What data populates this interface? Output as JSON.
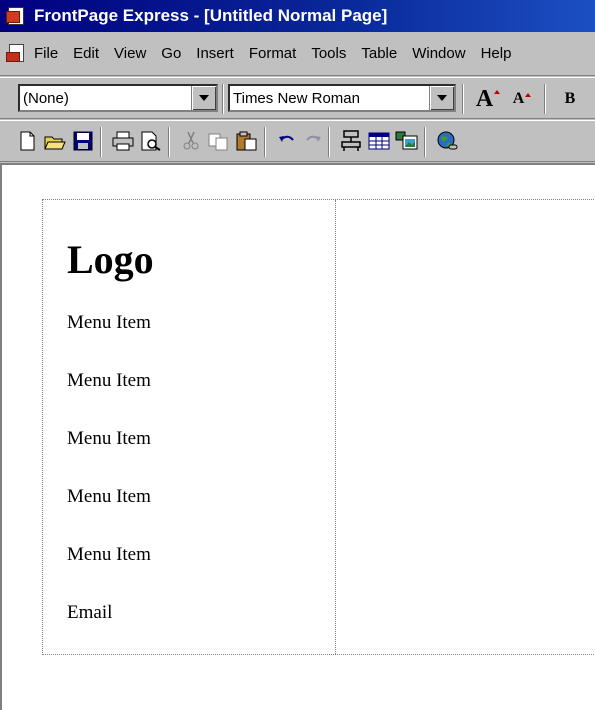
{
  "window": {
    "title": "FrontPage Express - [Untitled Normal Page]"
  },
  "menubar": {
    "items": [
      "File",
      "Edit",
      "View",
      "Go",
      "Insert",
      "Format",
      "Tools",
      "Table",
      "Window",
      "Help"
    ]
  },
  "format_toolbar": {
    "style_value": "(None)",
    "font_value": "Times New Roman",
    "increase_font_label": "A",
    "decrease_font_label": "A",
    "bold_label": "B"
  },
  "document": {
    "logo": "Logo",
    "menu_items": [
      "Menu Item",
      "Menu Item",
      "Menu Item",
      "Menu Item",
      "Menu Item"
    ],
    "email": "Email"
  },
  "colors": {
    "titlebar": "#000080",
    "chrome": "#c0c0c0",
    "canvas": "#ffffff"
  }
}
